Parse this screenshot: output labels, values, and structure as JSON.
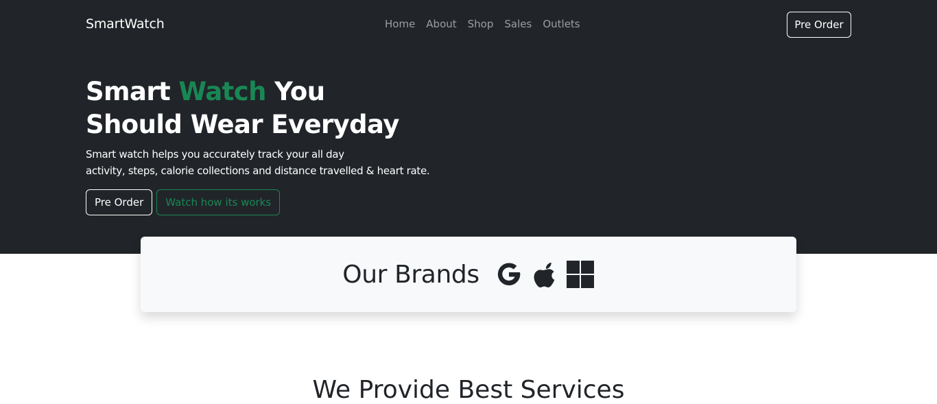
{
  "navbar": {
    "brand": "SmartWatch",
    "links": [
      {
        "label": "Home"
      },
      {
        "label": "About"
      },
      {
        "label": "Shop"
      },
      {
        "label": "Sales"
      },
      {
        "label": "Outlets"
      }
    ],
    "cta_label": "Pre Order"
  },
  "hero": {
    "headline_part1": "Smart ",
    "headline_accent": "Watch",
    "headline_part2": " You",
    "headline_line2": "Should Wear Everyday",
    "subtext_line1": "Smart watch helps you accurately track your all day",
    "subtext_line2": "activity, steps, calorie collections and distance travelled & heart rate.",
    "primary_button": "Pre Order",
    "secondary_button": "Watch how its works"
  },
  "brands": {
    "title": "Our Brands",
    "icons": [
      "google-icon",
      "apple-icon",
      "windows-icon"
    ]
  },
  "services": {
    "heading": "We Provide Best Services"
  },
  "colors": {
    "dark_bg": "#212529",
    "accent": "#198754",
    "card_bg": "#f8f9fa",
    "nav_link": "rgba(255,255,255,0.55)"
  }
}
